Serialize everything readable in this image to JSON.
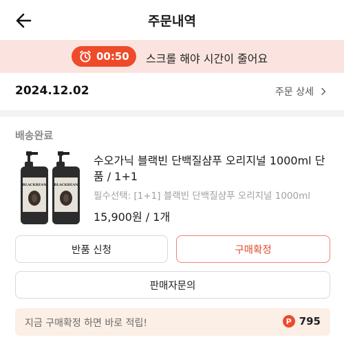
{
  "header": {
    "title": "주문내역",
    "back_icon": "arrow-left-icon"
  },
  "timer_bar": {
    "time": "00:50",
    "message": "스크롤 해야 시간이 줄어요",
    "icon": "alarm-clock-icon",
    "accent": "#ee4b2b",
    "background": "#fbe4df"
  },
  "order": {
    "date": "2024.12.02",
    "detail_label": "주문 상세"
  },
  "item": {
    "status": "배송완료",
    "name": "수오가닉 블랙빈 단백질샴푸 오리지널 1000ml 단품 / 1+1",
    "option": "필수선택: [1+1] 블랙빈 단백질샴푸 오리지널 1000ml",
    "price": "15,900원 / 1개",
    "image_labels": {
      "brand": "BLACKBEAN"
    }
  },
  "actions": {
    "return_label": "반품 신청",
    "confirm_label": "구매확정",
    "inquiry_label": "판매자문의"
  },
  "reward": {
    "message": "지금 구매확정 하면 바로 적립!",
    "points_icon_letter": "P",
    "points": "795"
  }
}
